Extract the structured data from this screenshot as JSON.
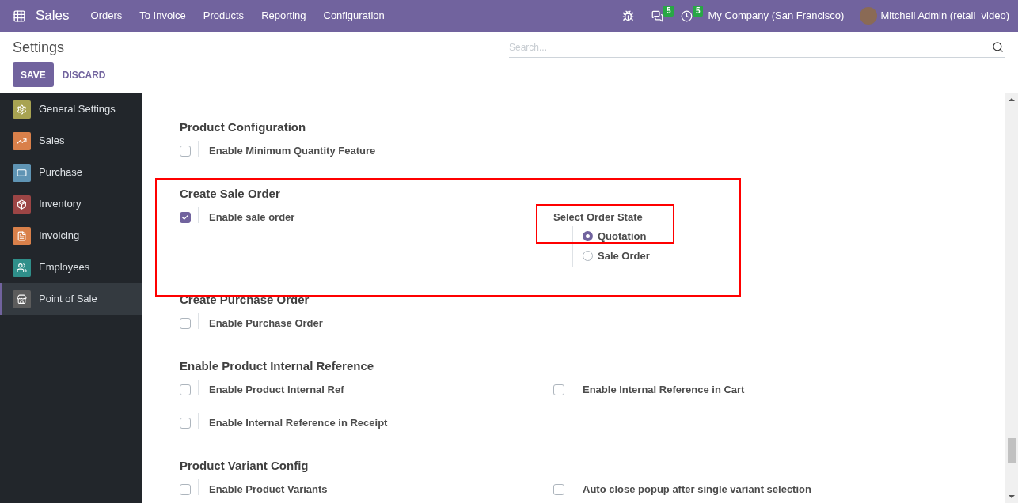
{
  "navbar": {
    "app": "Sales",
    "menu": [
      "Orders",
      "To Invoice",
      "Products",
      "Reporting",
      "Configuration"
    ],
    "indicators": [
      {
        "kind": "debug"
      },
      {
        "kind": "messages",
        "count": "5"
      },
      {
        "kind": "activities",
        "count": "5"
      }
    ],
    "company": "My Company (San Francisco)",
    "user": "Mitchell Admin (retail_video)"
  },
  "control_panel": {
    "title": "Settings",
    "search": {
      "placeholder": "Search..."
    },
    "buttons": [
      "SAVE",
      "DISCARD"
    ]
  },
  "sidebar": {
    "items": [
      {
        "kind": "general",
        "label": "General Settings",
        "color": "#a8a352",
        "selected": false
      },
      {
        "kind": "sales",
        "label": "Sales",
        "color": "#d9804a",
        "selected": false
      },
      {
        "kind": "purchase",
        "label": "Purchase",
        "color": "#5f94b4",
        "selected": false
      },
      {
        "kind": "inventory",
        "label": "Inventory",
        "color": "#9c4545",
        "selected": false
      },
      {
        "kind": "invoicing",
        "label": "Invoicing",
        "color": "#d9804a",
        "selected": false
      },
      {
        "kind": "employees",
        "label": "Employees",
        "color": "#2f8f8a",
        "selected": false
      },
      {
        "kind": "pos",
        "label": "Point of Sale",
        "color": "#5c5c5c",
        "selected": true
      }
    ]
  },
  "sections": [
    {
      "title": "Product Configuration",
      "settings": [
        {
          "kind": "checkbox",
          "label": "Enable Minimum Quantity Feature",
          "checked": false
        }
      ]
    },
    {
      "title": "Create Sale Order",
      "settings": [
        {
          "kind": "checkbox",
          "label": "Enable sale order",
          "checked": true
        },
        {
          "kind": "radio_group",
          "label": "Select Order State",
          "options": [
            {
              "label": "Quotation",
              "selected": true
            },
            {
              "label": "Sale Order",
              "selected": false
            }
          ]
        }
      ]
    },
    {
      "title": "Create Purchase Order",
      "settings": [
        {
          "kind": "checkbox",
          "label": "Enable Purchase Order",
          "checked": false
        }
      ]
    },
    {
      "title": "Enable Product Internal Reference",
      "settings": [
        {
          "kind": "checkbox",
          "label": "Enable Product Internal Ref",
          "checked": false
        },
        {
          "kind": "checkbox",
          "label": "Enable Internal Reference in Cart",
          "checked": false
        },
        {
          "kind": "checkbox",
          "label": "Enable Internal Reference in Receipt",
          "checked": false
        }
      ]
    },
    {
      "title": "Product Variant Config",
      "settings": [
        {
          "kind": "checkbox",
          "label": "Enable Product Variants",
          "checked": false
        },
        {
          "kind": "checkbox",
          "label": "Auto close popup after single variant selection",
          "checked": false
        }
      ]
    }
  ]
}
